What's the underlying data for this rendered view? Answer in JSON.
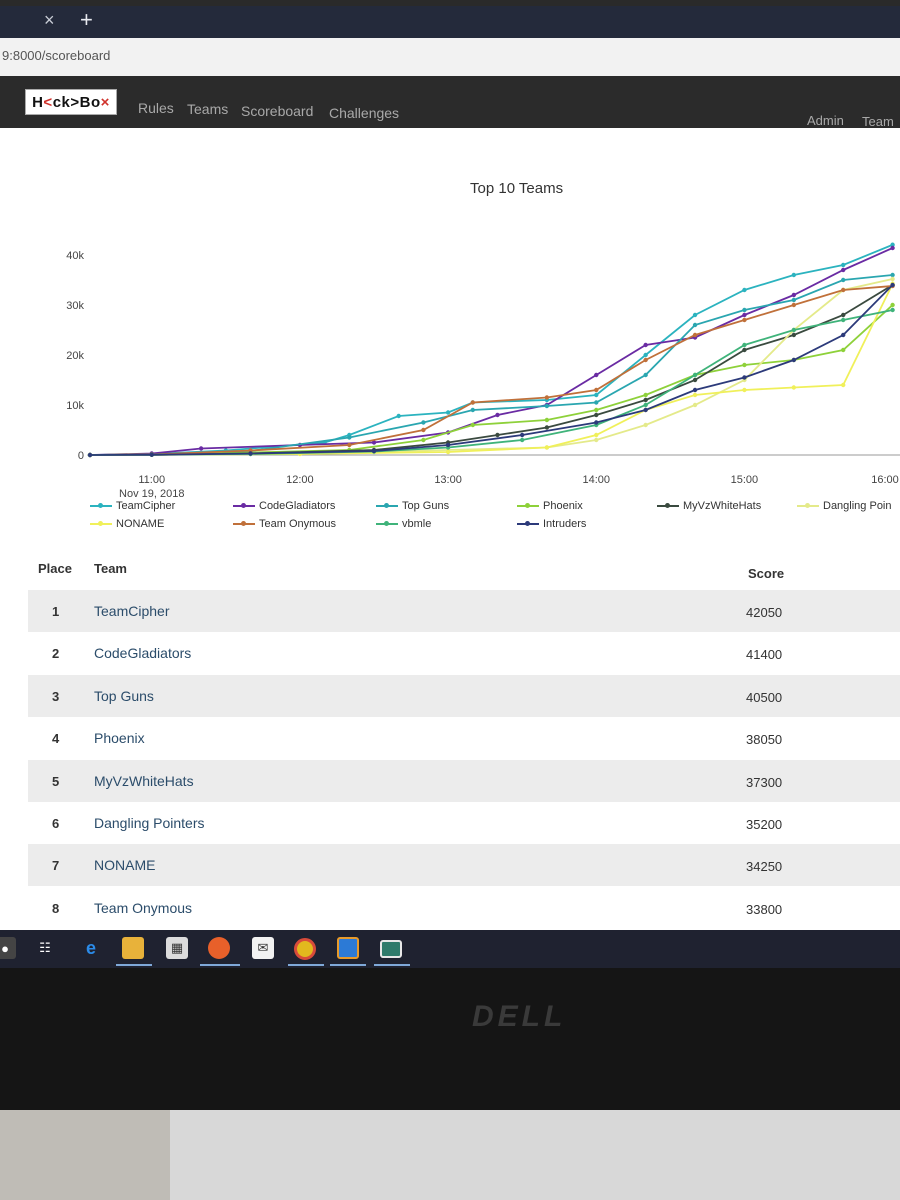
{
  "browser": {
    "tab_close_glyph": "×",
    "new_tab_glyph": "+",
    "url": "9:8000/scoreboard"
  },
  "nav": {
    "logo": {
      "pre": "H",
      "mid": "ck>Bo",
      "x1": "<",
      "x2": "×"
    },
    "links": [
      "Rules",
      "Teams",
      "Scoreboard",
      "Challenges"
    ],
    "right_links": [
      "Admin",
      "Team"
    ]
  },
  "chart_data": {
    "type": "line",
    "title": "Top 10 Teams",
    "ylim": [
      0,
      40000
    ],
    "yticks": [
      0,
      10000,
      20000,
      30000,
      40000
    ],
    "ytick_labels": [
      "0",
      "10k",
      "20k",
      "30k",
      "40k"
    ],
    "xlim": [
      "10:35",
      "16:00"
    ],
    "xticks": [
      "11:00",
      "12:00",
      "13:00",
      "14:00",
      "15:00",
      "16:00"
    ],
    "x_date_label": "Nov 19, 2018",
    "grid": false,
    "legend_position": "bottom",
    "series": [
      {
        "name": "TeamCipher",
        "color": "#2bb3bf",
        "points": [
          [
            "10:35",
            0
          ],
          [
            "11:00",
            200
          ],
          [
            "11:30",
            900
          ],
          [
            "12:10",
            2500
          ],
          [
            "12:20",
            4000
          ],
          [
            "12:40",
            7800
          ],
          [
            "13:00",
            8500
          ],
          [
            "13:10",
            10500
          ],
          [
            "13:40",
            11000
          ],
          [
            "14:00",
            12000
          ],
          [
            "14:20",
            20000
          ],
          [
            "14:40",
            28000
          ],
          [
            "15:00",
            33000
          ],
          [
            "15:20",
            36000
          ],
          [
            "15:40",
            38000
          ],
          [
            "16:00",
            42050
          ]
        ]
      },
      {
        "name": "CodeGladiators",
        "color": "#6a2ba3",
        "points": [
          [
            "10:35",
            0
          ],
          [
            "11:00",
            300
          ],
          [
            "11:20",
            1300
          ],
          [
            "12:00",
            2000
          ],
          [
            "12:30",
            2500
          ],
          [
            "13:00",
            4500
          ],
          [
            "13:20",
            8000
          ],
          [
            "13:40",
            10000
          ],
          [
            "14:00",
            16000
          ],
          [
            "14:20",
            22000
          ],
          [
            "14:40",
            23500
          ],
          [
            "15:00",
            28000
          ],
          [
            "15:20",
            32000
          ],
          [
            "15:40",
            37000
          ],
          [
            "16:00",
            41400
          ]
        ]
      },
      {
        "name": "Top Guns",
        "color": "#2aa6b0",
        "points": [
          [
            "10:35",
            0
          ],
          [
            "11:00",
            100
          ],
          [
            "11:40",
            800
          ],
          [
            "12:20",
            3500
          ],
          [
            "12:50",
            6500
          ],
          [
            "13:10",
            9000
          ],
          [
            "13:40",
            9800
          ],
          [
            "14:00",
            10500
          ],
          [
            "14:20",
            16000
          ],
          [
            "14:40",
            26000
          ],
          [
            "15:00",
            29000
          ],
          [
            "15:20",
            31000
          ],
          [
            "15:40",
            35000
          ],
          [
            "16:00",
            36000
          ]
        ]
      },
      {
        "name": "Phoenix",
        "color": "#8ed13a",
        "points": [
          [
            "10:35",
            0
          ],
          [
            "11:00",
            100
          ],
          [
            "11:40",
            500
          ],
          [
            "12:20",
            1000
          ],
          [
            "12:50",
            3000
          ],
          [
            "13:10",
            6000
          ],
          [
            "13:40",
            7000
          ],
          [
            "14:00",
            9000
          ],
          [
            "14:20",
            12000
          ],
          [
            "14:40",
            16000
          ],
          [
            "15:00",
            18000
          ],
          [
            "15:20",
            19000
          ],
          [
            "15:40",
            21000
          ],
          [
            "16:00",
            30000
          ]
        ]
      },
      {
        "name": "MyVzWhiteHats",
        "color": "#3a4a3f",
        "points": [
          [
            "10:35",
            0
          ],
          [
            "11:00",
            50
          ],
          [
            "11:40",
            300
          ],
          [
            "12:30",
            1000
          ],
          [
            "13:00",
            2500
          ],
          [
            "13:20",
            4000
          ],
          [
            "13:40",
            5500
          ],
          [
            "14:00",
            8000
          ],
          [
            "14:20",
            11000
          ],
          [
            "14:40",
            15000
          ],
          [
            "15:00",
            21000
          ],
          [
            "15:20",
            24000
          ],
          [
            "15:40",
            28000
          ],
          [
            "16:00",
            34000
          ]
        ]
      },
      {
        "name": "Dangling Pointers",
        "color": "#e4ea8a",
        "points": [
          [
            "10:35",
            0
          ],
          [
            "11:00",
            50
          ],
          [
            "11:40",
            200
          ],
          [
            "12:30",
            600
          ],
          [
            "13:00",
            1000
          ],
          [
            "13:40",
            1500
          ],
          [
            "14:00",
            3000
          ],
          [
            "14:20",
            6000
          ],
          [
            "14:40",
            10000
          ],
          [
            "15:00",
            15000
          ],
          [
            "15:20",
            25000
          ],
          [
            "15:40",
            33000
          ],
          [
            "16:00",
            35200
          ]
        ]
      },
      {
        "name": "NONAME",
        "color": "#f0f05a",
        "points": [
          [
            "10:35",
            0
          ],
          [
            "11:00",
            50
          ],
          [
            "12:00",
            200
          ],
          [
            "13:00",
            600
          ],
          [
            "13:40",
            1500
          ],
          [
            "14:00",
            4000
          ],
          [
            "14:20",
            9000
          ],
          [
            "14:40",
            12000
          ],
          [
            "15:00",
            13000
          ],
          [
            "15:20",
            13500
          ],
          [
            "15:40",
            14000
          ],
          [
            "16:00",
            34250
          ]
        ]
      },
      {
        "name": "Team Onymous",
        "color": "#c0703a",
        "points": [
          [
            "10:35",
            0
          ],
          [
            "11:00",
            100
          ],
          [
            "11:40",
            900
          ],
          [
            "12:20",
            2000
          ],
          [
            "12:50",
            5000
          ],
          [
            "13:10",
            10500
          ],
          [
            "13:40",
            11500
          ],
          [
            "14:00",
            13000
          ],
          [
            "14:20",
            19000
          ],
          [
            "14:40",
            24000
          ],
          [
            "15:00",
            27000
          ],
          [
            "15:20",
            30000
          ],
          [
            "15:40",
            33000
          ],
          [
            "16:00",
            33800
          ]
        ]
      },
      {
        "name": "vbmle",
        "color": "#3fb37a",
        "points": [
          [
            "10:35",
            0
          ],
          [
            "11:00",
            50
          ],
          [
            "11:40",
            200
          ],
          [
            "12:30",
            700
          ],
          [
            "13:00",
            1500
          ],
          [
            "13:30",
            3000
          ],
          [
            "14:00",
            6000
          ],
          [
            "14:20",
            10000
          ],
          [
            "14:40",
            16000
          ],
          [
            "15:00",
            22000
          ],
          [
            "15:20",
            25000
          ],
          [
            "15:40",
            27000
          ],
          [
            "16:00",
            29000
          ]
        ]
      },
      {
        "name": "Intruders",
        "color": "#2c3a7a",
        "points": [
          [
            "10:35",
            0
          ],
          [
            "11:00",
            50
          ],
          [
            "11:40",
            300
          ],
          [
            "12:30",
            800
          ],
          [
            "13:00",
            2000
          ],
          [
            "13:30",
            4000
          ],
          [
            "14:00",
            6500
          ],
          [
            "14:20",
            9000
          ],
          [
            "14:40",
            13000
          ],
          [
            "15:00",
            15500
          ],
          [
            "15:20",
            19000
          ],
          [
            "15:40",
            24000
          ],
          [
            "16:00",
            34000
          ]
        ]
      }
    ]
  },
  "legend_labels": [
    "TeamCipher",
    "CodeGladiators",
    "Top Guns",
    "Phoenix",
    "MyVzWhiteHats",
    "Dangling Poin",
    "NONAME",
    "Team Onymous",
    "vbmle",
    "Intruders"
  ],
  "table": {
    "headers": {
      "place": "Place",
      "team": "Team",
      "score": "Score"
    },
    "rows": [
      {
        "place": "1",
        "team": "TeamCipher",
        "score": "42050"
      },
      {
        "place": "2",
        "team": "CodeGladiators",
        "score": "41400"
      },
      {
        "place": "3",
        "team": "Top Guns",
        "score": "40500"
      },
      {
        "place": "4",
        "team": "Phoenix",
        "score": "38050"
      },
      {
        "place": "5",
        "team": "MyVzWhiteHats",
        "score": "37300"
      },
      {
        "place": "6",
        "team": "Dangling Pointers",
        "score": "35200"
      },
      {
        "place": "7",
        "team": "NONAME",
        "score": "34250"
      },
      {
        "place": "8",
        "team": "Team Onymous",
        "score": "33800"
      }
    ]
  },
  "taskbar": {
    "icons": [
      "microphone-icon",
      "task-view-icon",
      "edge-icon",
      "file-explorer-icon",
      "store-icon",
      "firefox-icon",
      "mail-icon",
      "chrome-icon",
      "remote-desktop-icon",
      "app-icon"
    ]
  },
  "monitor": {
    "brand": "DELL"
  }
}
